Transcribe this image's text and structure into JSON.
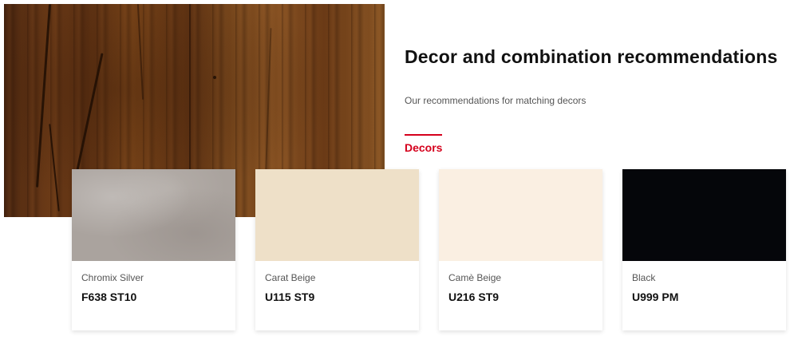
{
  "hero": {
    "image": "wood-oak-texture"
  },
  "header": {
    "title": "Decor and combination recommendations",
    "subtitle": "Our recommendations for matching decors"
  },
  "tabs": [
    {
      "label": "Decors",
      "active": true,
      "accent": "#d5001c"
    }
  ],
  "cards": [
    {
      "name": "Chromix Silver",
      "code": "F638 ST10",
      "swatch": "#aaa39e"
    },
    {
      "name": "Carat Beige",
      "code": "U115 ST9",
      "swatch": "#eee0c8"
    },
    {
      "name": "Camè Beige",
      "code": "U216 ST9",
      "swatch": "#faefe2"
    },
    {
      "name": "Black",
      "code": "U999 PM",
      "swatch": "#05060a"
    }
  ]
}
